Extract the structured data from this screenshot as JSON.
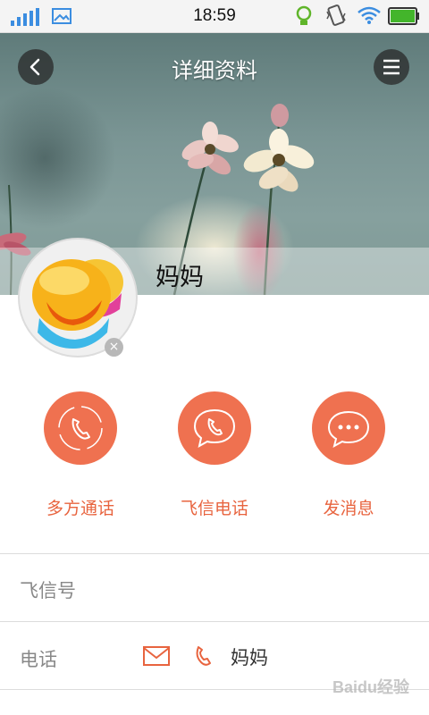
{
  "status_bar": {
    "time": "18:59",
    "icons": [
      "signal-icon",
      "image-icon",
      "bulb-icon",
      "vibrate-icon",
      "wifi-icon",
      "battery-icon"
    ]
  },
  "header": {
    "title": "详细资料",
    "contact_name": "妈妈"
  },
  "actions": [
    {
      "label": "多方通话",
      "icon": "conference-call-icon"
    },
    {
      "label": "飞信电话",
      "icon": "phone-call-icon"
    },
    {
      "label": "发消息",
      "icon": "chat-bubble-icon"
    }
  ],
  "rows": {
    "fetion_id_label": "飞信号",
    "phone_label": "电话",
    "phone_value": "妈妈"
  },
  "watermark": "Baidu经验",
  "colors": {
    "accent": "#ef7150",
    "accent_text": "#e8643f"
  }
}
